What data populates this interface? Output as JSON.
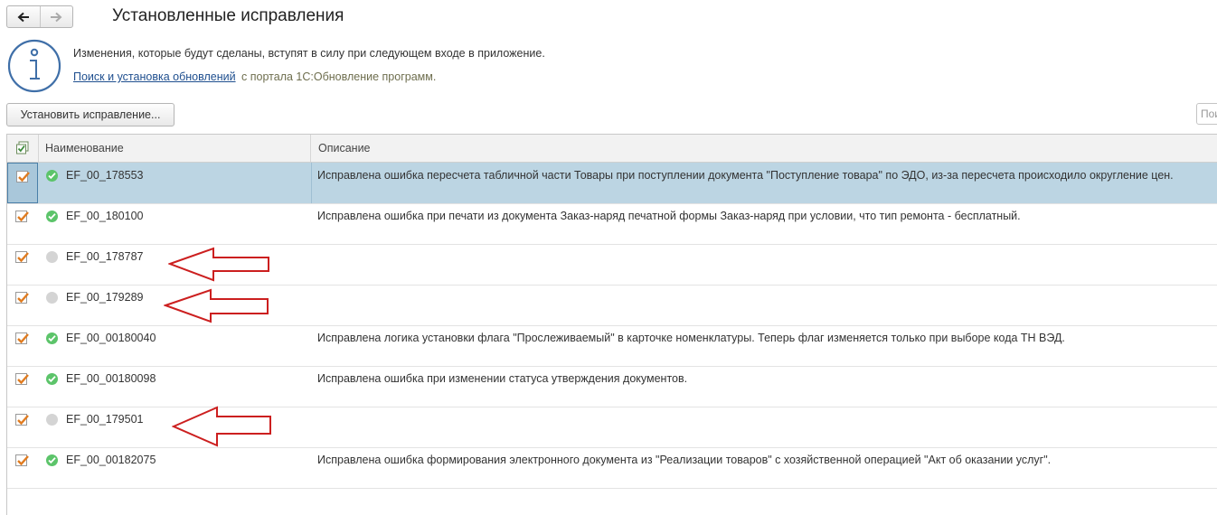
{
  "window": {
    "title": "Установленные исправления",
    "back_icon": "arrow-left-icon",
    "forward_icon": "arrow-right-icon"
  },
  "info": {
    "icon": "info-icon",
    "line1": "Изменения, которые будут сделаны, вступят в силу при следующем входе в приложение.",
    "link_text": "Поиск и установка обновлений",
    "link_suffix": "с портала 1С:Обновление программ."
  },
  "toolbar": {
    "install_button_label": "Установить исправление...",
    "search_placeholder": "Пои"
  },
  "table": {
    "columns": {
      "name": "Наименование",
      "description": "Описание"
    },
    "rows": [
      {
        "checked": true,
        "status": "ok",
        "name": "EF_00_178553",
        "description": "Исправлена ошибка пересчета табличной части Товары при поступлении документа \"Поступление товара\" по ЭДО, из-за пересчета происходило округление цен.",
        "selected": true
      },
      {
        "checked": true,
        "status": "ok",
        "name": "EF_00_180100",
        "description": "Исправлена ошибка при печати из документа Заказ-наряд печатной формы Заказ-наряд при условии, что тип ремонта - бесплатный."
      },
      {
        "checked": true,
        "status": "inactive",
        "name": "EF_00_178787",
        "description": ""
      },
      {
        "checked": true,
        "status": "inactive",
        "name": "EF_00_179289",
        "description": ""
      },
      {
        "checked": true,
        "status": "ok",
        "name": "EF_00_00180040",
        "description": "Исправлена логика установки флага \"Прослеживаемый\" в карточке номенклатуры. Теперь флаг изменяется только при выборе кода ТН ВЭД."
      },
      {
        "checked": true,
        "status": "ok",
        "name": "EF_00_00180098",
        "description": "Исправлена ошибка при изменении статуса утверждения документов."
      },
      {
        "checked": true,
        "status": "inactive",
        "name": "EF_00_179501",
        "description": ""
      },
      {
        "checked": true,
        "status": "ok",
        "name": "EF_00_00182075",
        "description": "Исправлена ошибка формирования электронного документа из \"Реализации товаров\" с хозяйственной операцией \"Акт об оказании услуг\"."
      }
    ]
  },
  "colors": {
    "checkmark": "#e07b1f",
    "status_ok": "#5cc46a",
    "status_inactive": "#d4d4d4",
    "selection": "#bcd5e3",
    "annotation_arrow": "#cc1f1f"
  }
}
